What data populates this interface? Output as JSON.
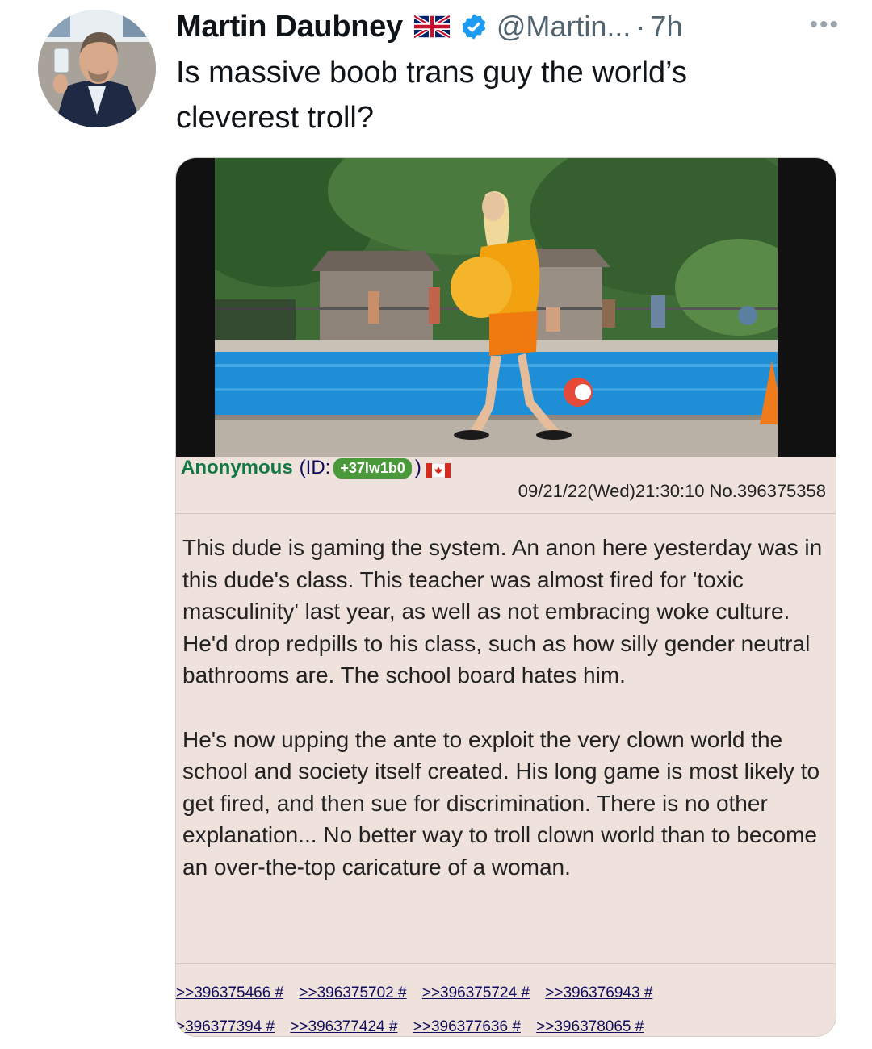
{
  "tweet": {
    "author_name": "Martin Daubney",
    "handle": "@Martin...",
    "separator": "·",
    "time": "7h",
    "more_icon": "•••",
    "text": "Is massive boob trans guy the world’s cleverest troll?"
  },
  "post": {
    "name": "Anonymous",
    "id_prefix": "(ID:",
    "id": "+37lw1b0",
    "id_suffix": ")",
    "date": "09/21/22(Wed)21:30:10 No.396375358",
    "paragraphs": [
      "This dude is gaming the system. An anon here yesterday was in this dude's class. This teacher was almost fired for 'toxic masculinity' last year, as well as not embracing woke culture. He'd drop redpills to his class, such as how silly gender neutral bathrooms are. The school board hates him.",
      "He's now upping the ante to exploit the very clown world the school and society itself created. His long game is most likely to get fired, and then sue for discrimination. There is no other explanation... No better way to troll clown world than to become an over-the-top caricature of a woman."
    ],
    "replies": [
      ">>396375466 #",
      ">>396375702 #",
      ">>396375724 #",
      ">>396376943 #",
      ">396377394 #",
      ">>396377424 #",
      ">>396377636 #",
      ">>396378065 #"
    ]
  },
  "colors": {
    "verified": "#1d9bf0",
    "post_bg": "#efe2dc",
    "anon_green": "#117743",
    "link": "#0f0c5d"
  }
}
